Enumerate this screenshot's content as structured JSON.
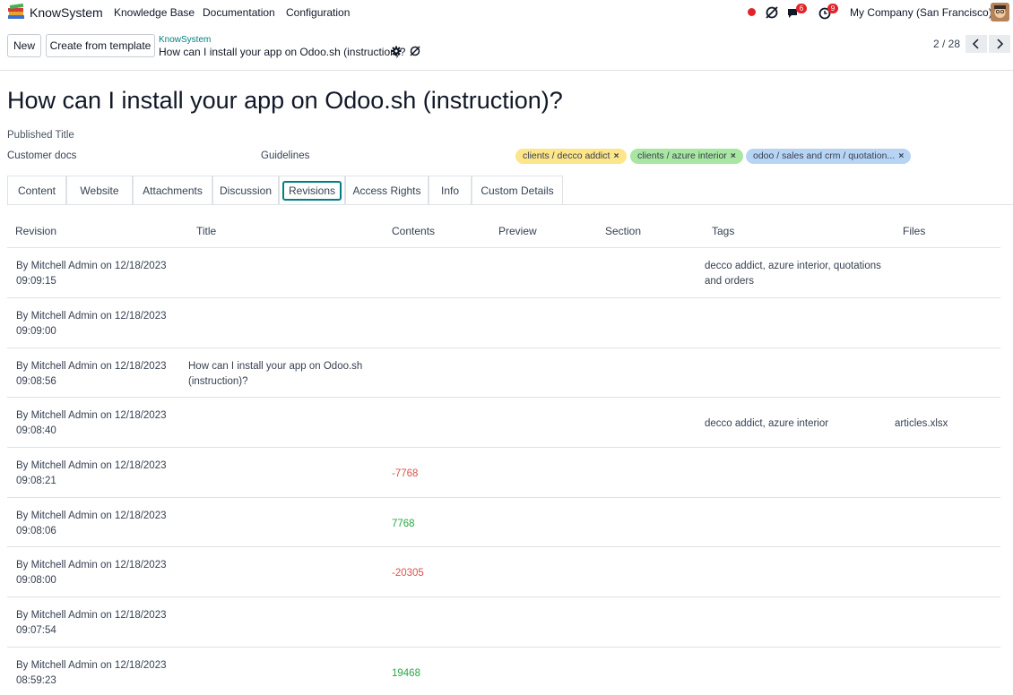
{
  "navbar": {
    "app_name": "KnowSystem",
    "menu": [
      "Knowledge Base",
      "Documentation",
      "Configuration"
    ],
    "chat_badge": "6",
    "activity_badge": "9",
    "company": "My Company (San Francisco)"
  },
  "control": {
    "new_label": "New",
    "template_label": "Create from template",
    "breadcrumb_parent": "KnowSystem",
    "breadcrumb_current": "How can I install your app on Odoo.sh (instruction)?",
    "pager": "2 / 28"
  },
  "form": {
    "title": "How can I install your app on Odoo.sh (instruction)?",
    "published_title_label": "Published Title",
    "section_value": "Customer docs",
    "type_value": "Guidelines",
    "tags": [
      {
        "label": "clients / decco addict",
        "color": "#fde58a"
      },
      {
        "label": "clients / azure interior",
        "color": "#a8e6a1"
      },
      {
        "label": "odoo / sales and crm / quotation...",
        "color": "#b8d4f5"
      }
    ]
  },
  "tabs": [
    "Content",
    "Website",
    "Attachments",
    "Discussion",
    "Revisions",
    "Access Rights",
    "Info",
    "Custom Details"
  ],
  "table": {
    "headers": [
      "Revision",
      "Title",
      "Contents",
      "Preview",
      "Section",
      "Tags",
      "Files"
    ],
    "rows": [
      {
        "revision": [
          "By Mitchell Admin on 12/18/2023",
          "09:09:15"
        ],
        "title": [
          "",
          ""
        ],
        "contents": "",
        "tags": [
          "decco addict, azure interior, quotations",
          "and orders"
        ],
        "files": ""
      },
      {
        "revision": [
          "By Mitchell Admin on 12/18/2023",
          "09:09:00"
        ],
        "title": [
          "",
          ""
        ],
        "contents": "",
        "tags": [
          "",
          ""
        ],
        "files": ""
      },
      {
        "revision": [
          "By Mitchell Admin on 12/18/2023",
          "09:08:56"
        ],
        "title": [
          "How can I install your app on Odoo.sh",
          "(instruction)?"
        ],
        "contents": "",
        "tags": [
          "",
          ""
        ],
        "files": ""
      },
      {
        "revision": [
          "By Mitchell Admin on 12/18/2023",
          "09:08:40"
        ],
        "title": [
          "",
          ""
        ],
        "contents": "",
        "tags": [
          "decco addict, azure interior",
          ""
        ],
        "files": "articles.xlsx"
      },
      {
        "revision": [
          "By Mitchell Admin on 12/18/2023",
          "09:08:21"
        ],
        "title": [
          "",
          ""
        ],
        "contents": "-7768",
        "tags": [
          "",
          ""
        ],
        "files": ""
      },
      {
        "revision": [
          "By Mitchell Admin on 12/18/2023",
          "09:08:06"
        ],
        "title": [
          "",
          ""
        ],
        "contents": "7768",
        "tags": [
          "",
          ""
        ],
        "files": ""
      },
      {
        "revision": [
          "By Mitchell Admin on 12/18/2023",
          "09:08:00"
        ],
        "title": [
          "",
          ""
        ],
        "contents": "-20305",
        "tags": [
          "",
          ""
        ],
        "files": ""
      },
      {
        "revision": [
          "By Mitchell Admin on 12/18/2023",
          "09:07:54"
        ],
        "title": [
          "",
          ""
        ],
        "contents": "",
        "tags": [
          "",
          ""
        ],
        "files": ""
      },
      {
        "revision": [
          "By Mitchell Admin on 12/18/2023",
          "08:59:23"
        ],
        "title": [
          "",
          ""
        ],
        "contents": "19468",
        "tags": [
          "",
          ""
        ],
        "files": ""
      }
    ]
  }
}
